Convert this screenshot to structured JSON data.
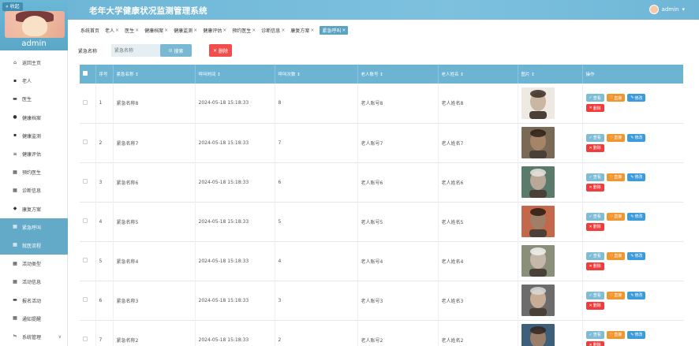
{
  "sidebar": {
    "collapse_label": "收起",
    "admin_name": "admin",
    "items": [
      {
        "label": "返回主页",
        "icon": "home-icon",
        "glyph": "⌂"
      },
      {
        "label": "老人",
        "icon": "people-icon",
        "glyph": "▪"
      },
      {
        "label": "医生",
        "icon": "doctor-icon",
        "glyph": "▬"
      },
      {
        "label": "健康档案",
        "icon": "user-icon",
        "glyph": "●"
      },
      {
        "label": "健康监测",
        "icon": "monitor-icon",
        "glyph": "▪"
      },
      {
        "label": "健康评估",
        "icon": "list-icon",
        "glyph": "≡"
      },
      {
        "label": "预约医生",
        "icon": "grid-icon",
        "glyph": "▦"
      },
      {
        "label": "诊断信息",
        "icon": "grid-icon",
        "glyph": "▦"
      },
      {
        "label": "康复方案",
        "icon": "pin-icon",
        "glyph": "◆"
      },
      {
        "label": "紧急呼叫",
        "icon": "grid-icon",
        "glyph": "▦",
        "active": true
      },
      {
        "label": "就医流程",
        "icon": "grid-icon",
        "glyph": "▦",
        "active": true
      },
      {
        "label": "活动类型",
        "icon": "grid-icon",
        "glyph": "▦"
      },
      {
        "label": "活动信息",
        "icon": "grid-icon",
        "glyph": "▦"
      },
      {
        "label": "报名活动",
        "icon": "print-icon",
        "glyph": "▬"
      },
      {
        "label": "通知提醒",
        "icon": "grid-icon",
        "glyph": "▦"
      },
      {
        "label": "系统管理",
        "icon": "settings-icon",
        "glyph": "≒",
        "chevron": "∨"
      }
    ]
  },
  "header": {
    "title": "老年大学健康状况监测管理系统",
    "user": "admin",
    "user_chevron": "▾"
  },
  "tabs": [
    {
      "label": "系统首页",
      "closable": false
    },
    {
      "label": "老人",
      "closable": true
    },
    {
      "label": "医生",
      "closable": true
    },
    {
      "label": "健康档案",
      "closable": true
    },
    {
      "label": "健康监测",
      "closable": true
    },
    {
      "label": "健康评估",
      "closable": true
    },
    {
      "label": "预约医生",
      "closable": true
    },
    {
      "label": "诊断信息",
      "closable": true
    },
    {
      "label": "康复方案",
      "closable": true
    },
    {
      "label": "紧急呼叫",
      "closable": true,
      "active": true
    }
  ],
  "search": {
    "label": "紧急名称",
    "placeholder": "紧急名称",
    "search_button": "搜索",
    "delete_button": "删除"
  },
  "table": {
    "columns": [
      "",
      "序号",
      "紧急名称 ↕",
      "呼叫时间 ↕",
      "呼叫次数 ↕",
      "老人账号 ↕",
      "老人姓名 ↕",
      "图片 ↕",
      "操作"
    ],
    "rows": [
      {
        "no": "1",
        "name": "紧急名称8",
        "time": "2024-05-18 15:18:33",
        "count": "8",
        "account": "老人账号8",
        "elder": "老人姓名8"
      },
      {
        "no": "2",
        "name": "紧急名称7",
        "time": "2024-05-18 15:18:33",
        "count": "7",
        "account": "老人账号7",
        "elder": "老人姓名7"
      },
      {
        "no": "3",
        "name": "紧急名称6",
        "time": "2024-05-18 15:18:33",
        "count": "6",
        "account": "老人账号6",
        "elder": "老人姓名6"
      },
      {
        "no": "4",
        "name": "紧急名称5",
        "time": "2024-05-18 15:18:33",
        "count": "5",
        "account": "老人账号5",
        "elder": "老人姓名5"
      },
      {
        "no": "5",
        "name": "紧急名称4",
        "time": "2024-05-18 15:18:33",
        "count": "4",
        "account": "老人账号4",
        "elder": "老人姓名4"
      },
      {
        "no": "6",
        "name": "紧急名称3",
        "time": "2024-05-18 15:18:33",
        "count": "3",
        "account": "老人账号3",
        "elder": "老人姓名3"
      },
      {
        "no": "7",
        "name": "紧急名称2",
        "time": "2024-05-18 15:18:33",
        "count": "2",
        "account": "老人账号2",
        "elder": "老人姓名2"
      }
    ],
    "actions": {
      "view": "查看",
      "fav": "直接",
      "edit": "修改",
      "delete": "删除"
    }
  },
  "colors": {
    "accent": "#6db3d2",
    "header": "#6fb6d6",
    "delete": "#f23c3c",
    "fav": "#f1962f",
    "edit": "#3e9bd9"
  }
}
